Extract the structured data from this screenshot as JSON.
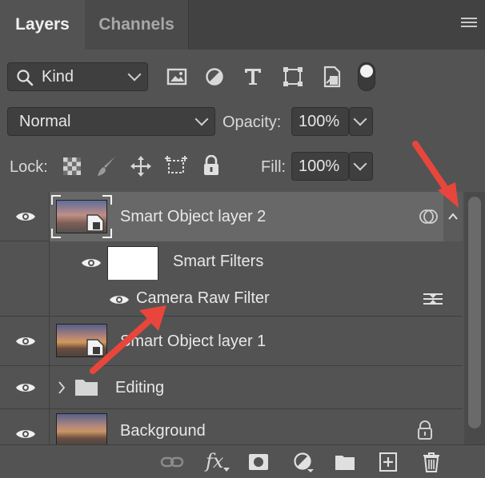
{
  "tabs": [
    {
      "label": "Layers"
    },
    {
      "label": "Channels"
    }
  ],
  "filter": {
    "kind_label": "Kind"
  },
  "blend": {
    "mode": "Normal",
    "opacity_label": "Opacity:",
    "opacity_value": "100%"
  },
  "lock": {
    "lock_label": "Lock:",
    "fill_label": "Fill:",
    "fill_value": "100%"
  },
  "layers": [
    {
      "name": "Smart Object layer 2"
    },
    {
      "name": "Smart Filters"
    },
    {
      "name": "Camera Raw Filter"
    },
    {
      "name": "Smart Object layer 1"
    },
    {
      "name": "Editing"
    },
    {
      "name": "Background"
    }
  ],
  "bottom_bar": {
    "fx_label": "fx"
  },
  "colors": {
    "panel": "#535353",
    "tabbar": "#424242",
    "field": "#3f3f3f",
    "arrow": "#e8463c",
    "selected_row": "#686868"
  }
}
